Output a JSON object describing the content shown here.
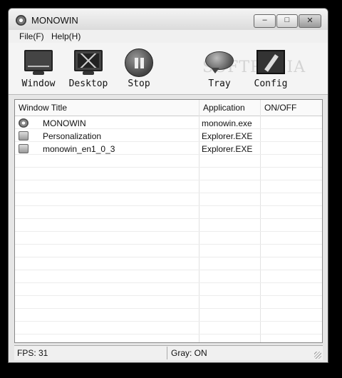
{
  "window": {
    "title": "MONOWIN"
  },
  "menu": {
    "items": [
      {
        "label": "File(F)"
      },
      {
        "label": "Help(H)"
      }
    ]
  },
  "toolbar": {
    "window_label": "Window",
    "desktop_label": "Desktop",
    "stop_label": "Stop",
    "tray_label": "Tray",
    "config_label": "Config"
  },
  "watermark": "SOFTPEDIA",
  "list": {
    "columns": [
      "Window Title",
      "Application",
      "ON/OFF"
    ],
    "rows": [
      {
        "icon": "gear-icon",
        "title": "MONOWIN",
        "application": "monowin.exe",
        "onoff": ""
      },
      {
        "icon": "folder-icon",
        "title": "Personalization",
        "application": "Explorer.EXE",
        "onoff": ""
      },
      {
        "icon": "folder-icon",
        "title": "monowin_en1_0_3",
        "application": "Explorer.EXE",
        "onoff": ""
      }
    ]
  },
  "status": {
    "fps": "FPS: 31",
    "gray": "Gray: ON"
  }
}
